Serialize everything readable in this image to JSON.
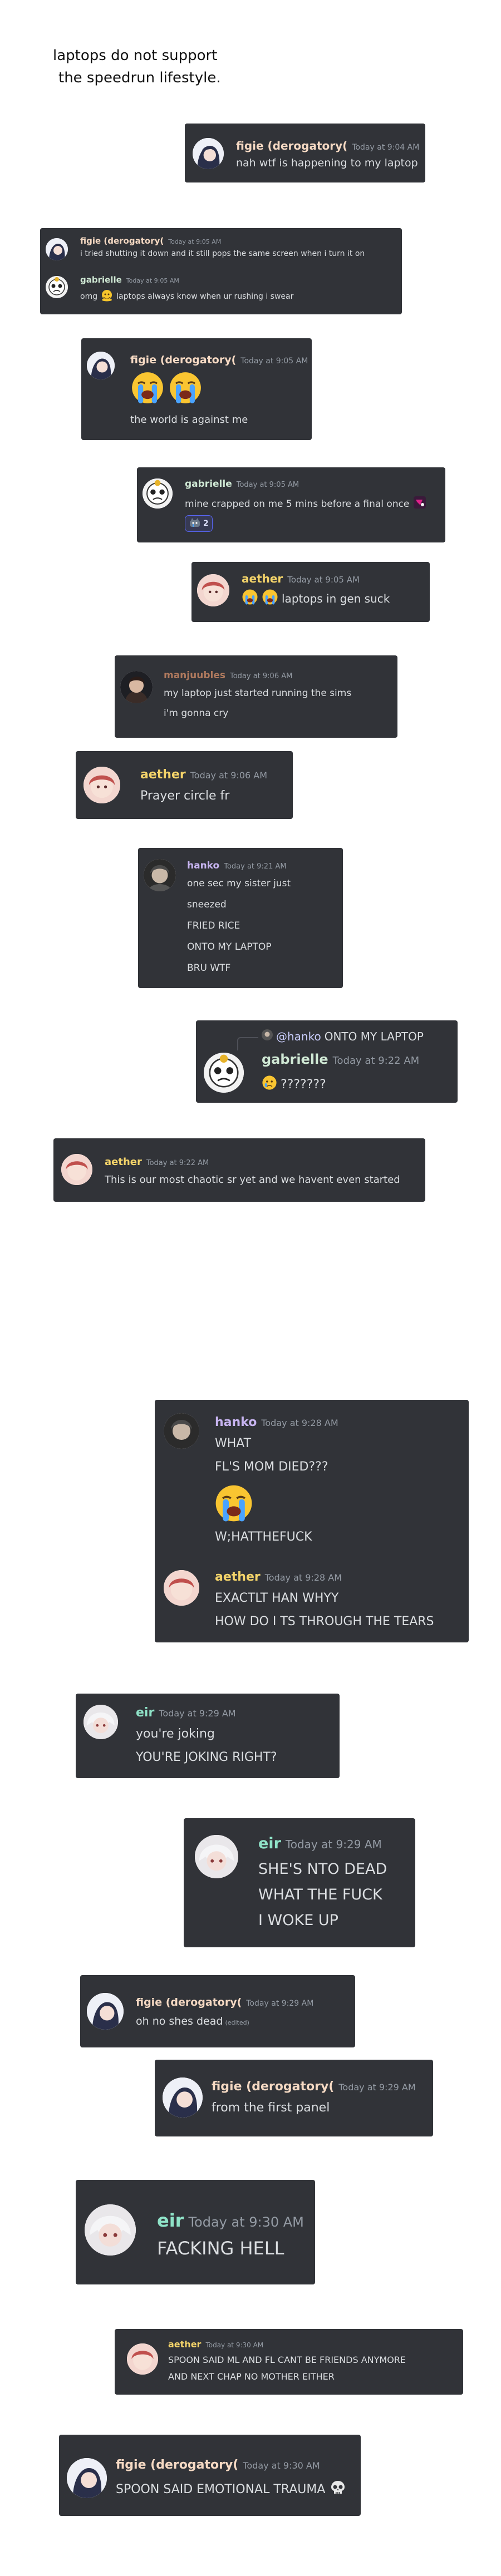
{
  "caption": {
    "line1": "laptops do not support",
    "line2": "the speedrun lifestyle."
  },
  "colors": {
    "card_bg": "#313338",
    "text": "#dbdee1",
    "timestamp": "#949ba4",
    "figie": "#f5d9c3",
    "gabrielle": "#cfe8d4",
    "aether": "#f4d46a",
    "manjuubles": "#b07a5e",
    "hanko": "#c7b4f0",
    "eir": "#8fe3c8",
    "mention": "#c9cdfb"
  },
  "messages": [
    {
      "author": "figie (derogatory(",
      "time": "Today at 9:04 AM",
      "lines": [
        "nah wtf is happening to my laptop"
      ]
    },
    {
      "author": "figie (derogatory(",
      "time": "Today at 9:05 AM",
      "lines": [
        "i tried shutting it down and it still pops the same screen when i turn it on"
      ]
    },
    {
      "author": "gabrielle",
      "time": "Today at 9:05 AM",
      "lines": [
        "omg",
        "laptops always know when ur rushing i swear"
      ],
      "icons": [
        "melting-face"
      ]
    },
    {
      "author": "figie (derogatory(",
      "time": "Today at 9:05 AM",
      "lines": [
        "the world is against me"
      ],
      "icons": [
        "loudly-crying-face",
        "loudly-crying-face"
      ]
    },
    {
      "author": "gabrielle",
      "time": "Today at 9:05 AM",
      "lines": [
        "mine crapped on me 5 mins before a final once"
      ],
      "reaction_count": "2",
      "icons": [
        "custom-emoji",
        "crying-cat"
      ]
    },
    {
      "author": "aether",
      "time": "Today at 9:05 AM",
      "lines": [
        "laptops in gen suck"
      ],
      "icons": [
        "loudly-crying-face",
        "loudly-crying-face"
      ]
    },
    {
      "author": "manjuubles",
      "time": "Today at 9:06 AM",
      "lines": [
        "my laptop just started running the sims",
        "i'm gonna cry"
      ]
    },
    {
      "author": "aether",
      "time": "Today at 9:06 AM",
      "lines": [
        "Prayer circle fr"
      ]
    },
    {
      "author": "hanko",
      "time": "Today at 9:21 AM",
      "lines": [
        "one sec my sister just",
        "sneezed",
        "FRIED RICE",
        "ONTO MY LAPTOP",
        "BRU WTF"
      ]
    },
    {
      "author": "gabrielle",
      "time": "Today at 9:22 AM",
      "reply_to": "@hanko",
      "reply_text": "ONTO MY LAPTOP",
      "lines": [
        "???????"
      ],
      "icons": [
        "crying-face"
      ]
    },
    {
      "author": "aether",
      "time": "Today at 9:22 AM",
      "lines": [
        "This is our most chaotic sr yet and we havent even started"
      ]
    },
    {
      "author": "hanko",
      "time": "Today at 9:28 AM",
      "lines": [
        "WHAT",
        "FL'S MOM DIED???",
        "W;HATTHEFUCK"
      ],
      "icons": [
        "loudly-crying-face"
      ]
    },
    {
      "author": "aether",
      "time": "Today at 9:28 AM",
      "lines": [
        "EXACTLT HAN WHYY",
        "HOW DO I TS THROUGH THE TEARS"
      ]
    },
    {
      "author": "eir",
      "time": "Today at 9:29 AM",
      "lines": [
        "you're joking",
        "YOU'RE JOKING RIGHT?"
      ]
    },
    {
      "author": "eir",
      "time": "Today at 9:29 AM",
      "lines": [
        "SHE'S NTO DEAD",
        "WHAT THE FUCK",
        "I WOKE UP"
      ]
    },
    {
      "author": "figie (derogatory(",
      "time": "Today at 9:29 AM",
      "lines": [
        "oh no shes dead"
      ],
      "edited": "(edited)"
    },
    {
      "author": "figie (derogatory(",
      "time": "Today at 9:29 AM",
      "lines": [
        "from the first panel"
      ]
    },
    {
      "author": "eir",
      "time": "Today at 9:30 AM",
      "lines": [
        "FACKING HELL"
      ]
    },
    {
      "author": "aether",
      "time": "Today at 9:30 AM",
      "lines": [
        "SPOON SAID ML AND FL CANT BE FRIENDS ANYMORE",
        "AND NEXT CHAP NO MOTHER EITHER"
      ]
    },
    {
      "author": "figie (derogatory(",
      "time": "Today at 9:30 AM",
      "lines": [
        "SPOON SAID EMOTIONAL TRAUMA"
      ],
      "icons": [
        "skull"
      ]
    }
  ]
}
